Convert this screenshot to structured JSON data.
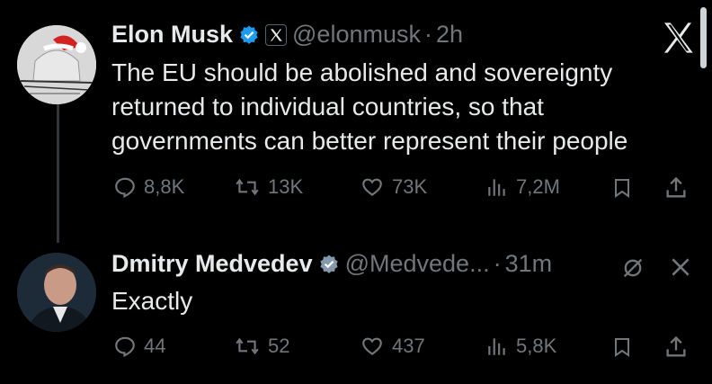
{
  "tweets": [
    {
      "name": "Elon Musk",
      "handle": "@elonmusk",
      "separator": "·",
      "time": "2h",
      "lines": [
        "The EU should be abolished and sovereignty",
        "returned to individual countries, so that",
        "governments can better represent their people"
      ],
      "metrics": {
        "replies": "8,8K",
        "reposts": "13K",
        "likes": "73K",
        "views": "7,2M"
      }
    },
    {
      "name": "Dmitry Medvedev",
      "handle": "@Medvede...",
      "separator": "·",
      "time": "31m",
      "lines": [
        "Exactly"
      ],
      "metrics": {
        "replies": "44",
        "reposts": "52",
        "likes": "437",
        "views": "5,8K"
      }
    }
  ],
  "colors": {
    "background": "#000000",
    "text": "#e7e9ea",
    "muted": "#71767b",
    "verified": "#1d9bf0"
  },
  "icons": [
    "x-logo-icon",
    "verified-icon",
    "reply-icon",
    "repost-icon",
    "like-icon",
    "views-icon",
    "bookmark-icon",
    "share-icon",
    "mute-icon",
    "close-icon"
  ]
}
